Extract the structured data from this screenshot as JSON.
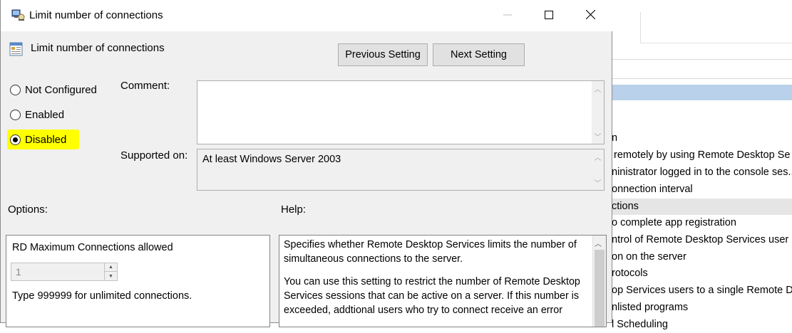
{
  "window": {
    "title": "Limit number of connections",
    "controls": {
      "minimize": "—",
      "maximize": "□",
      "close": "✕"
    }
  },
  "setting": {
    "name": "Limit number of connections",
    "previous_button": "Previous Setting",
    "next_button": "Next Setting"
  },
  "state": {
    "options": [
      {
        "label": "Not Configured",
        "selected": false
      },
      {
        "label": "Enabled",
        "selected": false
      },
      {
        "label": "Disabled",
        "selected": true
      }
    ],
    "highlight_color": "#ffff00"
  },
  "comment": {
    "label": "Comment:",
    "value": ""
  },
  "supported": {
    "label": "Supported on:",
    "value": "At least Windows Server 2003"
  },
  "options_section": {
    "label": "Options:",
    "title": "RD Maximum Connections allowed",
    "spinner_value": "1",
    "hint": "Type 999999 for unlimited connections."
  },
  "help_section": {
    "label": "Help:",
    "paragraphs": [
      "Specifies whether Remote Desktop Services limits the number of simultaneous connections to the server.",
      "You can use this setting to restrict the number of Remote Desktop Services sessions that can be active on a server. If this number is exceeded, addtional users who try to connect receive an error"
    ]
  },
  "background_window": {
    "list": [
      "n",
      "remotely by using Remote Desktop Se",
      "ninistrator logged in to the console ses..",
      "onnection interval",
      "ctions",
      "o complete app registration",
      "ntrol of Remote Desktop Services user",
      "on on the server",
      "rotocols",
      "op Services users to a single Remote De",
      "nlisted programs",
      "l Scheduling"
    ],
    "selected_index": 4
  }
}
